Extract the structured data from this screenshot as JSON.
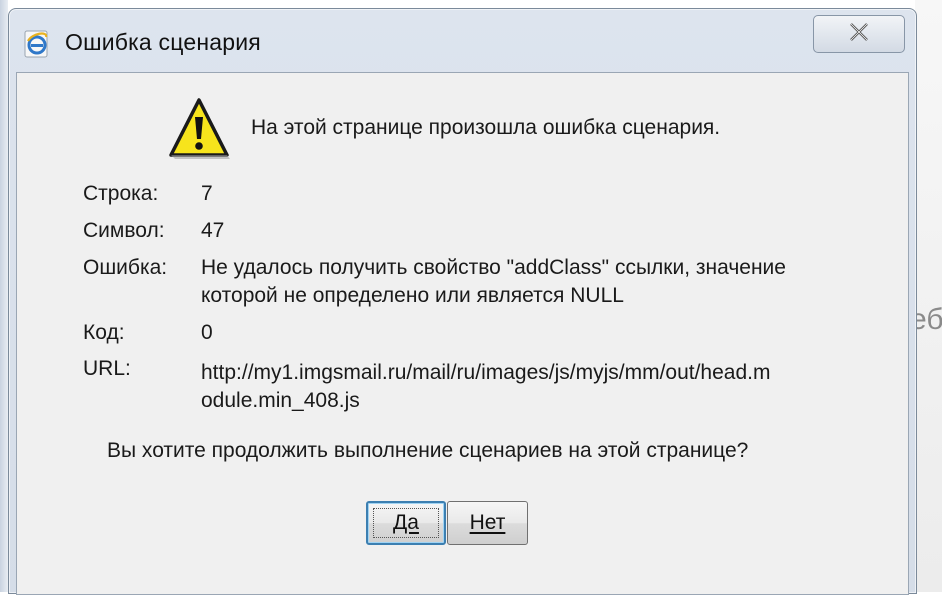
{
  "window": {
    "title": "Ошибка сценария",
    "close_label": "X"
  },
  "background": {
    "peek_text": "еб"
  },
  "message": {
    "headline": "На этой странице произошла ошибка сценария."
  },
  "details": {
    "line_label": "Строка:",
    "line_value": "7",
    "char_label": "Символ:",
    "char_value": "47",
    "error_label": "Ошибка:",
    "error_value_line1": "Не удалось получить свойство \"addClass\" ссылки, значение",
    "error_value_line2": "которой не определено или является NULL",
    "code_label": "Код:",
    "code_value": "0",
    "url_label": "URL:",
    "url_value_line1": "http://my1.imgsmail.ru/mail/ru/images/js/myjs/mm/out/head.m",
    "url_value_line2": "odule.min_408.js"
  },
  "prompt": {
    "question": "Вы хотите продолжить выполнение сценариев на этой странице?"
  },
  "buttons": {
    "yes_label": "Да",
    "no_label": "Нет"
  },
  "colors": {
    "dialog_frame": "#d5dde8",
    "client_bg": "#f0f0f0",
    "warning_yellow": "#f5e11a",
    "focus_border": "#3c7fb1"
  },
  "icons": {
    "title": "ie-logo-icon",
    "message": "warning-triangle-icon",
    "close": "close-x-icon"
  }
}
